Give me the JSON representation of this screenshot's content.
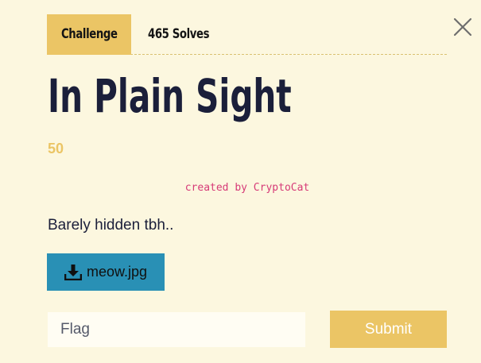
{
  "modal": {
    "tabs": [
      {
        "label": "Challenge",
        "active": true
      },
      {
        "label": "465 Solves",
        "active": false
      }
    ],
    "close_icon": "close-icon",
    "title": "In Plain Sight",
    "points": "50",
    "author": "created by CryptoCat",
    "description": "Barely hidden tbh..",
    "file": {
      "icon": "download-icon",
      "label": "meow.jpg"
    },
    "flag_input": {
      "value": "",
      "placeholder": "Flag"
    },
    "submit_label": "Submit"
  },
  "colors": {
    "background": "#fcf7df",
    "accent": "#ebc565",
    "file_button": "#2990b5",
    "author_text": "#d63a77",
    "title_text": "#1b1f3a"
  }
}
